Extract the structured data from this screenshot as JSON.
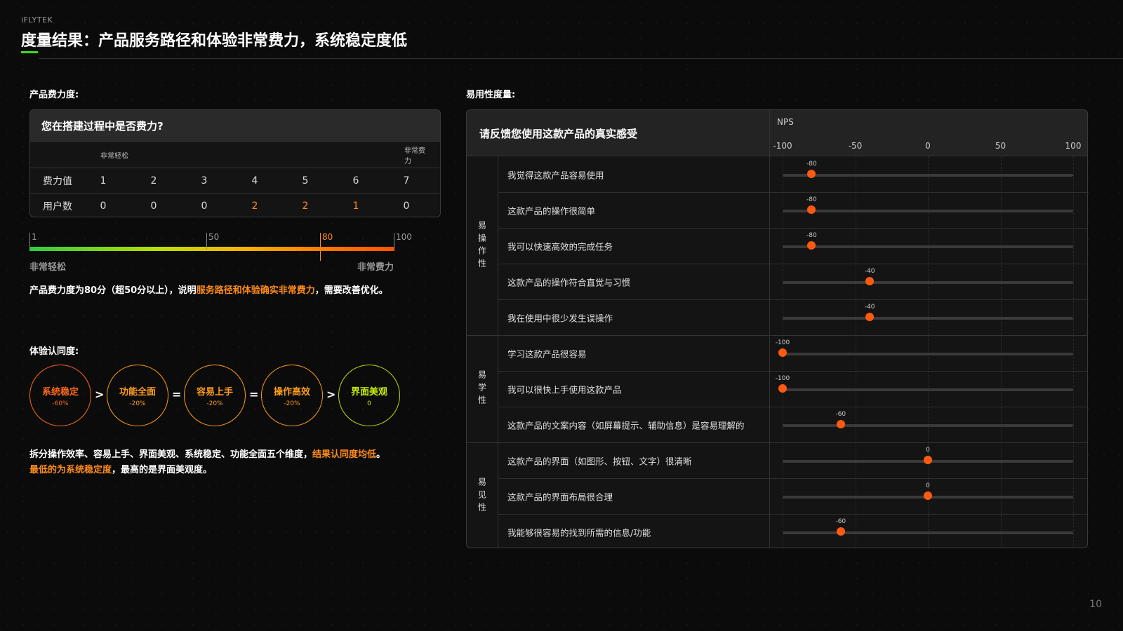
{
  "header": {
    "brand": "iFLYTEK",
    "title": "度量结果：产品服务路径和体验非常费力，系统稳定度低",
    "accent_color": "#3cdc1e"
  },
  "effort": {
    "section_label": "产品费力度:",
    "question": "您在搭建过程中是否费力?",
    "scale_low": "非常轻松",
    "scale_high": "非常费力",
    "row1_label": "费力值",
    "row2_label": "用户数",
    "values": [
      "1",
      "2",
      "3",
      "4",
      "5",
      "6",
      "7"
    ],
    "counts": [
      "0",
      "0",
      "0",
      "2",
      "2",
      "1",
      "0"
    ],
    "bar": {
      "start": "1",
      "mid": "50",
      "marker": "80",
      "end": "100",
      "marker_value": 80,
      "low_label": "非常轻松",
      "high_label": "非常费力"
    },
    "conclusion_prefix": "产品费力度为80分（超50分以上），说明",
    "conclusion_highlight": "服务路径和体验确实非常费力",
    "conclusion_suffix": "，需要改善优化。"
  },
  "experience": {
    "section_label": "体验认同度:",
    "dimensions": [
      {
        "name": "系统稳定",
        "value": "-60%"
      },
      {
        "name": "功能全面",
        "value": "-20%"
      },
      {
        "name": "容易上手",
        "value": "-20%"
      },
      {
        "name": "操作高效",
        "value": "-20%"
      },
      {
        "name": "界面美观",
        "value": "0"
      }
    ],
    "operators": [
      ">",
      "=",
      "=",
      ">"
    ],
    "conclusion_part1": "拆分操作效率、容易上手、界面美观、系统稳定、功能全面五个维度，",
    "conclusion_highlight1": "结果认同度均低",
    "conclusion_part2": "。",
    "conclusion_highlight2": "最低的为系统稳定度",
    "conclusion_part3": "，最高的是界面美观度。",
    "colors": {
      "orange": "#ff6a1a",
      "amber": "#ff9d1a",
      "green": "#c8f000"
    }
  },
  "usability": {
    "section_label": "易用性度量:",
    "question": "请反馈您使用这款产品的真实感受",
    "nps_label": "NPS",
    "axis": [
      "-100",
      "-50",
      "0",
      "50",
      "100"
    ],
    "groups": [
      {
        "name": "易操作性",
        "items": [
          {
            "label": "我觉得这款产品容易使用",
            "score": -80,
            "score_text": "-80"
          },
          {
            "label": "这款产品的操作很简单",
            "score": -80,
            "score_text": "-80"
          },
          {
            "label": "我可以快速高效的完成任务",
            "score": -80,
            "score_text": "-80"
          },
          {
            "label": "这款产品的操作符合直觉与习惯",
            "score": -40,
            "score_text": "-40"
          },
          {
            "label": "我在使用中很少发生误操作",
            "score": -40,
            "score_text": "-40"
          }
        ]
      },
      {
        "name": "易学性",
        "items": [
          {
            "label": "学习这款产品很容易",
            "score": -100,
            "score_text": "-100"
          },
          {
            "label": "我可以很快上手使用这款产品",
            "score": -100,
            "score_text": "-100"
          },
          {
            "label": "这款产品的文案内容（如屏幕提示、辅助信息）是容易理解的",
            "score": -60,
            "score_text": "-60"
          }
        ]
      },
      {
        "name": "易见性",
        "items": [
          {
            "label": "这款产品的界面（如图形、按钮、文字）很清晰",
            "score": 0,
            "score_text": "0"
          },
          {
            "label": "这款产品的界面布局很合理",
            "score": 0,
            "score_text": "0"
          },
          {
            "label": "我能够很容易的找到所需的信息/功能",
            "score": -60,
            "score_text": "-60"
          }
        ]
      }
    ],
    "dot_color": "#ff5a0f"
  },
  "footer": {
    "page_number": "10"
  }
}
